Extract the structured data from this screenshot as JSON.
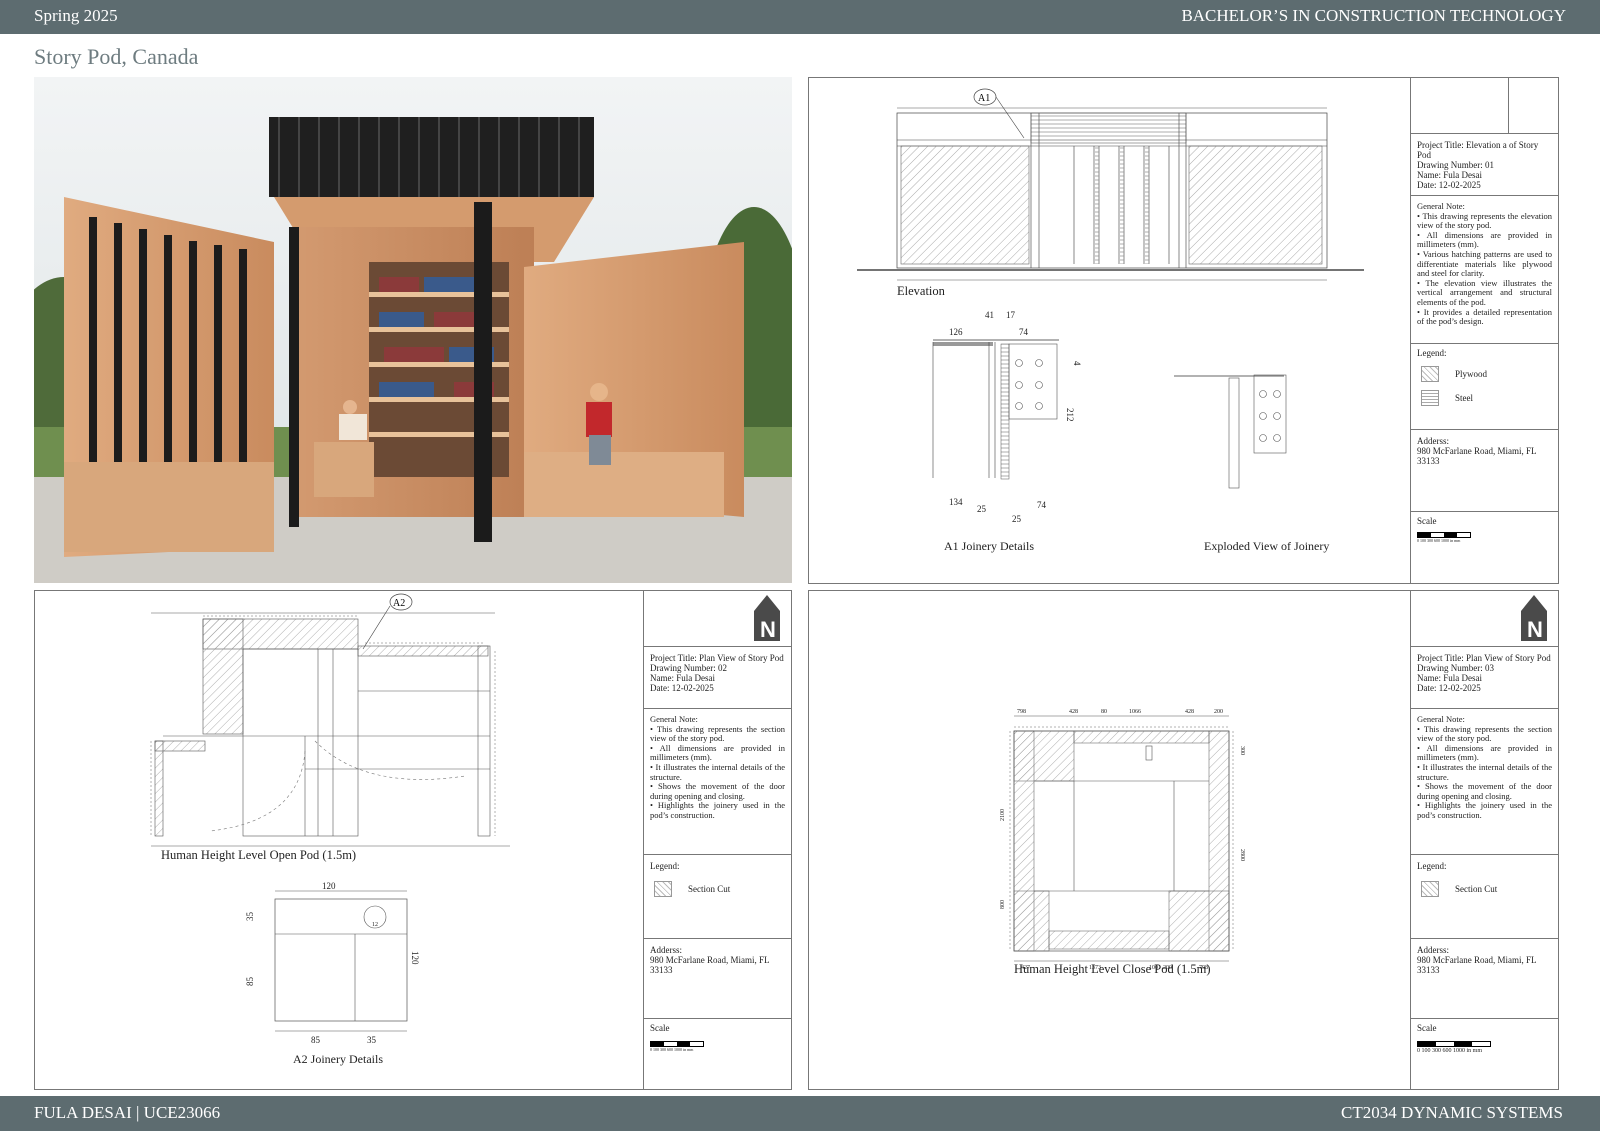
{
  "header": {
    "left": "Spring 2025",
    "right": "BACHELOR’S IN CONSTRUCTION TECHNOLOGY"
  },
  "page_title": "Story Pod, Canada",
  "footer": {
    "left": "FULA DESAI | UCE23066",
    "right": "CT2034 DYNAMIC SYSTEMS"
  },
  "sheet1": {
    "captions": {
      "elevation": "Elevation",
      "a1": "A1 Joinery Details",
      "exploded": "Exploded View of Joinery"
    },
    "callout": "A1",
    "a1_dims": [
      "126",
      "41",
      "17",
      "74",
      "4",
      "212",
      "134",
      "25",
      "25",
      "74"
    ],
    "titleblock": {
      "project_title": "Project Title: Elevation a of Story Pod",
      "drawing_number": "Drawing Number: 01",
      "name": "Name: Fula Desai",
      "date": "Date: 12-02-2025",
      "general_note_label": "General Note:",
      "notes": [
        "This drawing represents the elevation view of the story pod.",
        "All dimensions are provided in millimeters (mm).",
        "Various hatching patterns are used to differentiate materials like plywood and steel for clarity.",
        "The elevation view illustrates the vertical arrangement and structural elements of the pod.",
        "It provides a detailed representation of the pod’s design."
      ],
      "legend_label": "Legend:",
      "legend": [
        "Plywood",
        "Steel"
      ],
      "address_label": "Adderss:",
      "address": "980 McFarlane Road, Miami, FL 33133",
      "scale_label": "Scale",
      "scale_text": "0 100 300 600 1000 in mm"
    }
  },
  "sheet2": {
    "captions": {
      "open_pod": "Human Height Level Open Pod (1.5m)",
      "a2": "A2 Joinery Details"
    },
    "callout": "A2",
    "a2_dims": [
      "120",
      "35",
      "85",
      "120",
      "12",
      "85",
      "35"
    ],
    "titleblock": {
      "project_title": "Project Title: Plan View of Story Pod",
      "drawing_number": "Drawing Number: 02",
      "name": "Name: Fula Desai",
      "date": "Date: 12-02-2025",
      "general_note_label": "General Note:",
      "notes": [
        "This drawing represents the section view of the story pod.",
        "All dimensions are provided in millimeters (mm).",
        "It illustrates the internal details of the structure.",
        "Shows the movement of the door during opening and closing.",
        "Highlights the joinery used in the pod’s construction."
      ],
      "legend_label": "Legend:",
      "legend": [
        "Section Cut"
      ],
      "address_label": "Adderss:",
      "address": "980 McFarlane Road, Miami, FL 33133",
      "scale_label": "Scale",
      "scale_text": "0 100 300 600 1000 in mm"
    }
  },
  "sheet3": {
    "captions": {
      "close_pod": "Human Height Level Close Pod (1.5m)"
    },
    "top_dims": [
      "798",
      "428",
      "80",
      "1066",
      "428",
      "200"
    ],
    "bottom_dims": [
      "427",
      "1373",
      "100",
      "200",
      "798"
    ],
    "left_dims": [
      "2100",
      "800"
    ],
    "right_dims": [
      "300",
      "2800"
    ],
    "titleblock": {
      "project_title": "Project Title: Plan View of Story Pod",
      "drawing_number": "Drawing Number: 03",
      "name": "Name: Fula Desai",
      "date": "Date: 12-02-2025",
      "general_note_label": "General Note:",
      "notes": [
        "This drawing represents the section view of the story pod.",
        "All dimensions are provided in millimeters (mm).",
        "It illustrates the internal details of the structure.",
        "Shows the movement of the door during opening and closing.",
        "Highlights the joinery used in the pod’s construction."
      ],
      "legend_label": "Legend:",
      "legend": [
        "Section Cut"
      ],
      "address_label": "Adderss:",
      "address": "980 McFarlane Road, Miami, FL 33133",
      "scale_label": "Scale",
      "scale_text": "0 100 300 600 1000 in mm"
    }
  },
  "colors": {
    "band": "#5d6c70",
    "wood": "#c98b5e",
    "steel": "#222222",
    "title": "#6e7c80"
  }
}
